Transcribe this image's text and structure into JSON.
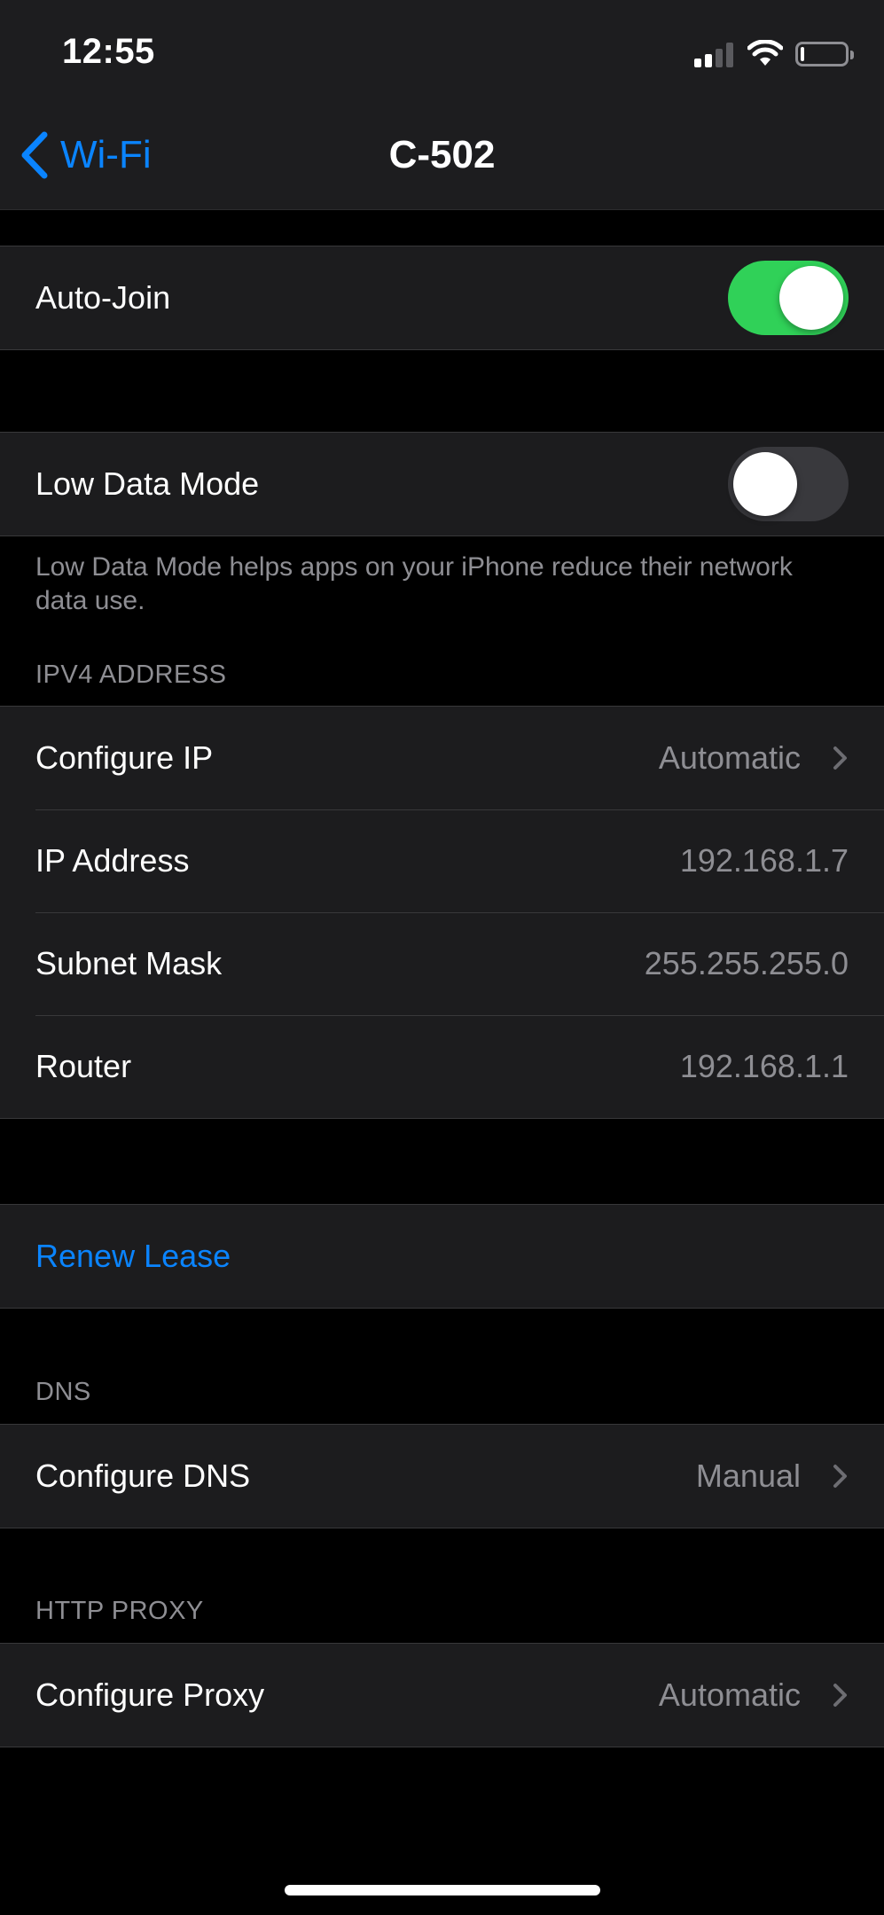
{
  "status_bar": {
    "time": "12:55",
    "signal_icon": "cellular-signal-icon",
    "wifi_icon": "wifi-icon",
    "battery_icon": "battery-low-icon"
  },
  "nav": {
    "back_label": "Wi-Fi",
    "back_icon": "chevron-left-icon",
    "title": "C-502"
  },
  "auto_join": {
    "label": "Auto-Join",
    "enabled": true
  },
  "low_data_mode": {
    "label": "Low Data Mode",
    "enabled": false,
    "footer": "Low Data Mode helps apps on your iPhone reduce their network data use."
  },
  "ipv4": {
    "header": "IPV4 ADDRESS",
    "rows": [
      {
        "label": "Configure IP",
        "value": "Automatic",
        "disclosure": true
      },
      {
        "label": "IP Address",
        "value": "192.168.1.7",
        "disclosure": false
      },
      {
        "label": "Subnet Mask",
        "value": "255.255.255.0",
        "disclosure": false
      },
      {
        "label": "Router",
        "value": "192.168.1.1",
        "disclosure": false
      }
    ]
  },
  "renew_lease": {
    "label": "Renew Lease"
  },
  "dns": {
    "header": "DNS",
    "configure_label": "Configure DNS",
    "configure_value": "Manual"
  },
  "http_proxy": {
    "header": "HTTP PROXY",
    "configure_label": "Configure Proxy",
    "configure_value": "Automatic"
  },
  "colors": {
    "accent": "#0a84ff",
    "toggle_on": "#30d158",
    "toggle_off": "#39393d",
    "secondary_text": "#8e8e93",
    "cell_background": "#1c1c1e",
    "background": "#000000"
  }
}
